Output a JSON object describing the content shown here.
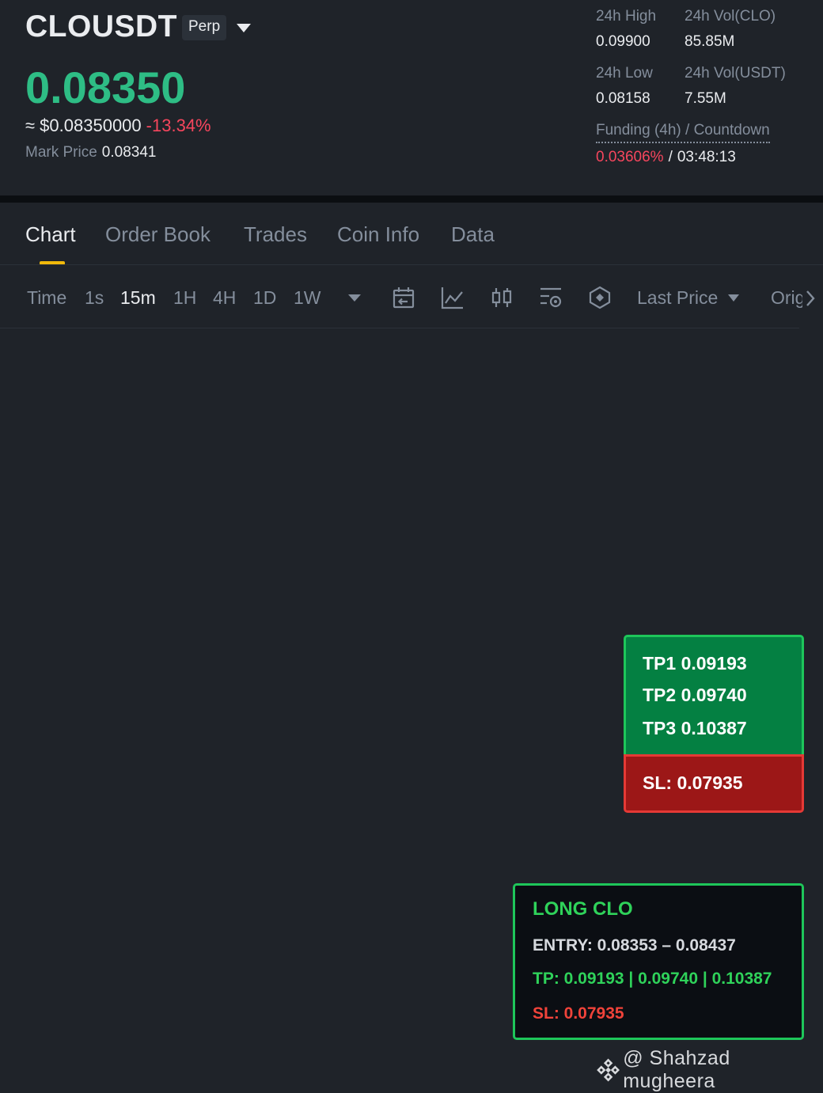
{
  "header": {
    "symbol": "CLOUSDT",
    "contract_type": "Perp",
    "last_price": "0.08350",
    "usd_price": "≈ $0.08350000",
    "change_pct": "-13.34%",
    "mark_price_label": "Mark Price",
    "mark_price": "0.08341",
    "price_up_color": "#2ebd85",
    "price_down_color": "#f6465d"
  },
  "stats": {
    "high_label": "24h High",
    "high_value": "0.09900",
    "vol_base_label": "24h Vol(CLO)",
    "vol_base_value": "85.85M",
    "low_label": "24h Low",
    "low_value": "0.08158",
    "vol_quote_label": "24h Vol(USDT)",
    "vol_quote_value": "7.55M",
    "funding_label": "Funding (4h) / Countdown",
    "funding_rate": "0.03606%",
    "funding_separator": "/",
    "countdown": "03:48:13"
  },
  "tabs": [
    {
      "label": "Chart",
      "active": true
    },
    {
      "label": "Order Book"
    },
    {
      "label": "Trades"
    },
    {
      "label": "Coin Info"
    },
    {
      "label": "Data"
    }
  ],
  "toolbar": {
    "intervals": [
      {
        "label": "Time"
      },
      {
        "label": "1s"
      },
      {
        "label": "15m",
        "active": true
      },
      {
        "label": "1H"
      },
      {
        "label": "4H"
      },
      {
        "label": "1D"
      },
      {
        "label": "1W"
      }
    ],
    "icons": [
      "calendar-icon",
      "indicator-icon",
      "candlestick-icon",
      "chart-settings-icon",
      "depth-icon"
    ],
    "price_type": "Last Price",
    "overflow_label": "Original"
  },
  "tp_box": {
    "tp1": "TP1 0.09193",
    "tp2": "TP2 0.09740",
    "tp3": "TP3 0.10387",
    "sl": "SL: 0.07935",
    "tp_color": "#048042",
    "sl_color": "#9c1717"
  },
  "signal": {
    "title": "LONG CLO",
    "entry": "ENTRY: 0.08353 – 0.08437",
    "tp": "TP: 0.09193 | 0.09740 | 0.10387",
    "sl": "SL: 0.07935"
  },
  "watermark": {
    "text": "@ Shahzad mugheera"
  }
}
